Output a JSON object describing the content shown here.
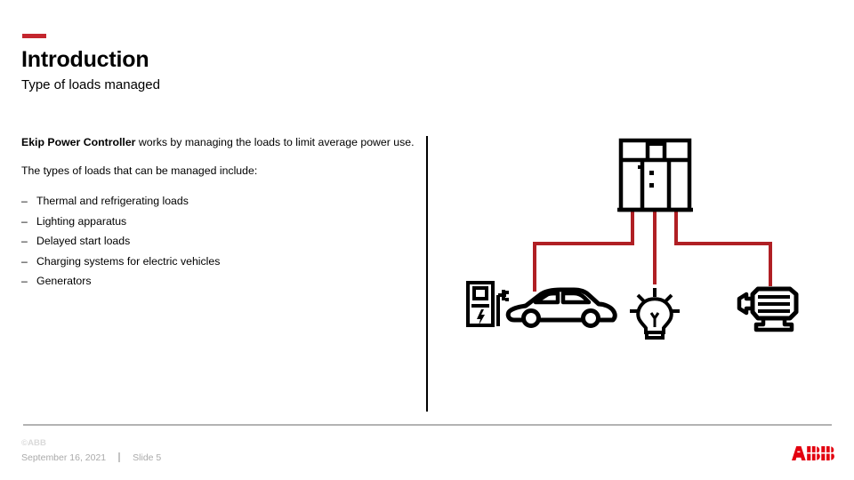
{
  "slide": {
    "title": "Introduction",
    "subtitle": "Type of loads managed",
    "accent_color": "#c4262e",
    "divider_color": "#000000"
  },
  "body": {
    "paragraph_1_lead": "Ekip Power Controller",
    "paragraph_1_rest": " works by managing the loads to limit average power use.",
    "paragraph_2": "The types of loads that can be managed include:",
    "bullet_dash": "–",
    "bullets": [
      "Thermal and refrigerating loads",
      "Lighting apparatus",
      "Delayed start loads",
      "Charging systems for electric vehicles",
      "Generators"
    ]
  },
  "diagram": {
    "line_color": "#b01f24",
    "icon_color": "#000000",
    "source_icon": "switchgear-cabinet-icon",
    "loads": [
      {
        "icon": "ev-charging-station-icon",
        "name": "ev-charging-station"
      },
      {
        "icon": "car-icon",
        "name": "electric-vehicle"
      },
      {
        "icon": "lightbulb-icon",
        "name": "lighting"
      },
      {
        "icon": "electric-motor-icon",
        "name": "motor-generator"
      }
    ]
  },
  "footer": {
    "copyright": "©ABB",
    "date": "September 16, 2021",
    "slide_number": "Slide 5",
    "logo_text": "ABB",
    "logo_color": "#e3000f",
    "rule_color": "#b3b3b3"
  }
}
